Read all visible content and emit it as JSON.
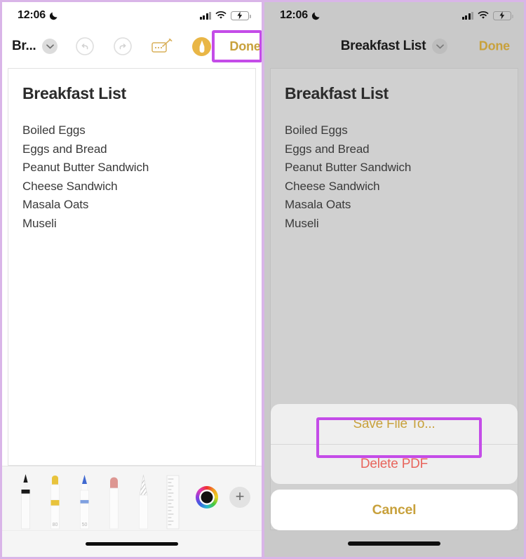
{
  "panels": {
    "left": {
      "status": {
        "time": "12:06",
        "moon_icon": "crescent-moon-icon",
        "cellular_icon": "cellular-signal-icon",
        "wifi_icon": "wifi-icon",
        "battery_icon": "battery-charging-icon"
      },
      "nav": {
        "title": "Br...",
        "chevron_icon": "chevron-down-icon",
        "undo_icon": "undo-icon",
        "redo_icon": "redo-icon",
        "markup_icon": "signature-markup-icon",
        "pen_icon": "markup-pen-icon",
        "done_label": "Done"
      },
      "document": {
        "title": "Breakfast List",
        "lines": [
          "Boiled Eggs",
          "Eggs and Bread",
          "Peanut Butter Sandwich",
          "Cheese Sandwich",
          "Masala Oats",
          "Museli"
        ]
      },
      "toolbar": {
        "tools": [
          {
            "name": "pen-tool",
            "color": "#1a1a1a",
            "size": ""
          },
          {
            "name": "highlighter-tool",
            "color": "#e8c33c",
            "size": "80"
          },
          {
            "name": "marker-tool",
            "color": "#4069d0",
            "size": "50"
          },
          {
            "name": "eraser-tool",
            "color": "#e09a96",
            "size": ""
          },
          {
            "name": "pencil-tool",
            "color": "#b9b9b9",
            "size": ""
          },
          {
            "name": "ruler-tool",
            "color": "#cfcfcf",
            "size": ""
          }
        ],
        "color_picker_name": "color-picker-icon",
        "color_picker_value": "#111111",
        "add_label": "+"
      },
      "home_indicator": "home-indicator"
    },
    "right": {
      "status": {
        "time": "12:06",
        "moon_icon": "crescent-moon-icon",
        "cellular_icon": "cellular-signal-icon",
        "wifi_icon": "wifi-icon",
        "battery_icon": "battery-charging-icon"
      },
      "nav": {
        "title": "Breakfast List",
        "chevron_icon": "chevron-down-icon",
        "done_label": "Done"
      },
      "document": {
        "title": "Breakfast List",
        "lines": [
          "Boiled Eggs",
          "Eggs and Bread",
          "Peanut Butter Sandwich",
          "Cheese Sandwich",
          "Masala Oats",
          "Museli"
        ]
      },
      "action_sheet": {
        "save_label": "Save File To...",
        "delete_label": "Delete PDF",
        "cancel_label": "Cancel"
      },
      "home_indicator": "home-indicator"
    }
  },
  "annotations": {
    "highlight_color": "#c44ce8",
    "done_highlight_target": "Done",
    "save_highlight_target": "Save File To..."
  }
}
